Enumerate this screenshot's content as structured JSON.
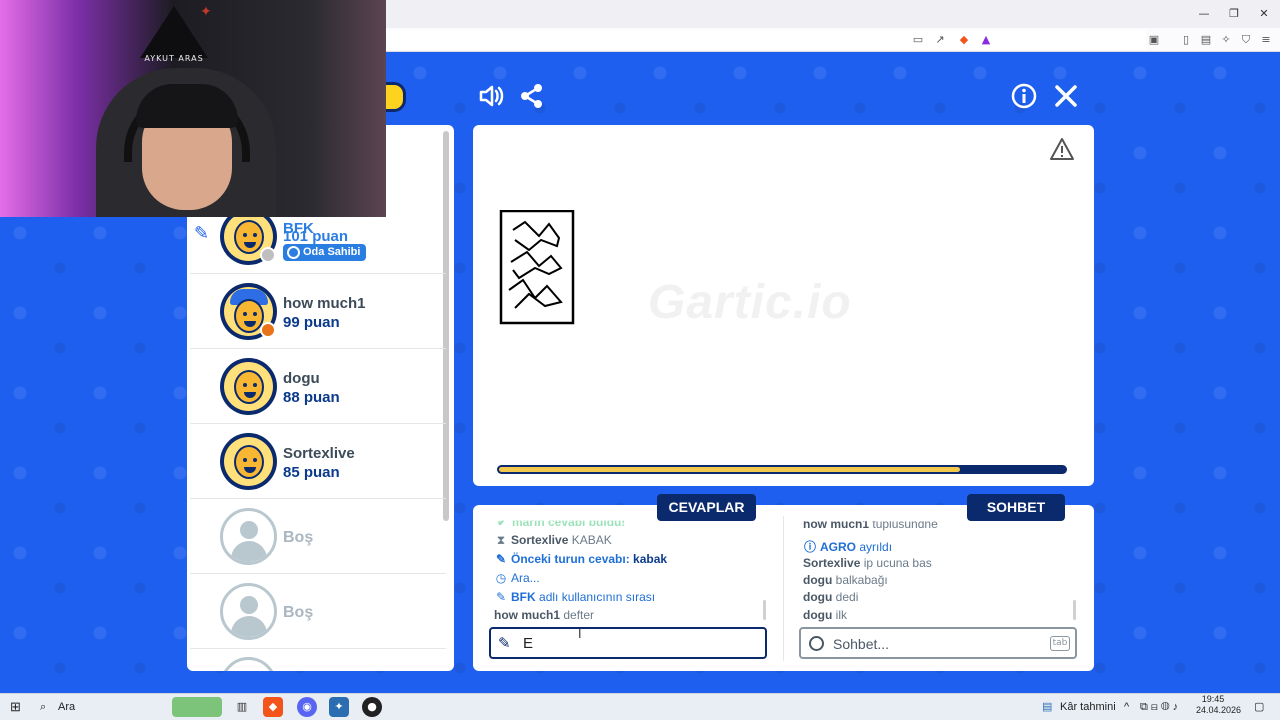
{
  "players": [
    {
      "name": "BFK",
      "points": "101 puan",
      "badge": "Oda Sahibi",
      "drawing": true,
      "status_color": "#bfbfbf"
    },
    {
      "name": "how much1",
      "points": "99 puan",
      "status_color": "#e8731a"
    },
    {
      "name": "dogu",
      "points": "88 puan"
    },
    {
      "name": "Sortexlive",
      "points": "85 puan"
    },
    {
      "name": "Boş"
    },
    {
      "name": "Boş"
    }
  ],
  "canvas": {
    "watermark": "Gartic.io",
    "progress_fraction": 0.82
  },
  "answers": {
    "tab_label": "CEVAPLAR",
    "messages": [
      {
        "icon": "check-icon",
        "text": "marin cevabı buldu!"
      },
      {
        "icon": "hourglass-icon",
        "user": "Sortexlive",
        "text": "KABAK"
      },
      {
        "icon": "pencil-icon",
        "text": "Önceki turun cevabı:",
        "strong": "kabak"
      },
      {
        "icon": "clock-icon",
        "text": "Ara..."
      },
      {
        "icon": "pencil-icon",
        "user": "BFK",
        "text": "adlı kullanıcının sırası"
      },
      {
        "user": "how much1",
        "text": "defter"
      }
    ],
    "input_value": "E"
  },
  "chat": {
    "tab_label": "SOHBET",
    "messages": [
      {
        "user": "how much1",
        "text": "tuplusundne"
      },
      {
        "icon": "info-icon",
        "user": "AGRO",
        "text": "ayrıldı"
      },
      {
        "user": "Sortexlive",
        "text": "ip ucuna bas"
      },
      {
        "user": "dogu",
        "text": "balkabağı"
      },
      {
        "user": "dogu",
        "text": "dedi"
      },
      {
        "user": "dogu",
        "text": "ilk"
      }
    ],
    "placeholder": "Sohbet...",
    "tab_hint": "tab"
  },
  "webcam": {
    "logo_text": "AYKUT ARAS"
  },
  "taskbar": {
    "search_label": "Ara",
    "weather_label": "Kâr tahmini",
    "time": "19:45",
    "date": "24.04.2026"
  },
  "colors": {
    "game_blue": "#1f5ff0",
    "navy": "#0b2a6d",
    "accent_blue": "#1f6fd6",
    "progress": "#f2c94c"
  }
}
